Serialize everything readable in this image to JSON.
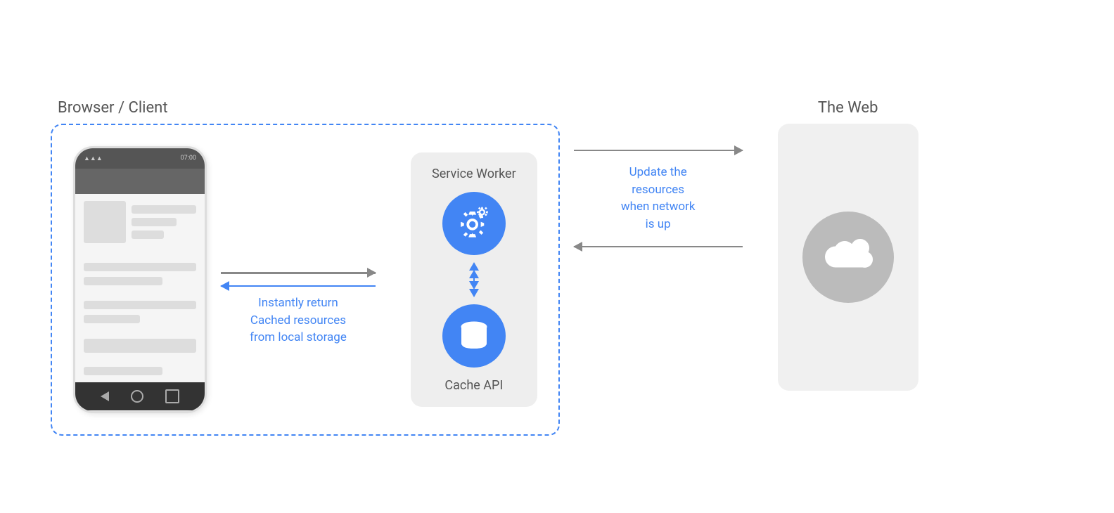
{
  "labels": {
    "browser_client": "Browser / Client",
    "the_web": "The Web",
    "service_worker": "Service Worker",
    "cache_api": "Cache API",
    "instantly_return": "Instantly return",
    "cached_resources": "Cached resources",
    "from_local_storage": "from local storage",
    "update_the": "Update the",
    "resources": "resources",
    "when_network": "when network",
    "is_up": "is up"
  },
  "colors": {
    "blue": "#4285F4",
    "gray_arrow": "#888888",
    "dashed_border": "#4285F4",
    "service_worker_bg": "#eeeeee",
    "web_bg": "#f0f0f0",
    "cloud_bg": "#bbbbbb",
    "phone_border": "#dddddd",
    "phone_top": "#555555",
    "phone_header": "#666666",
    "phone_content": "#f5f5f5",
    "phone_placeholder": "#dddddd",
    "phone_bottom": "#333333"
  }
}
